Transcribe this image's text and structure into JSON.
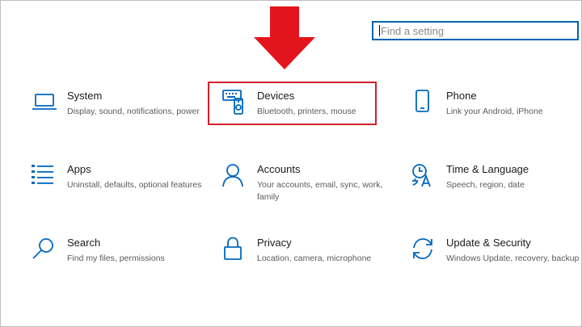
{
  "search": {
    "placeholder": "Find a setting"
  },
  "tiles": [
    {
      "title": "System",
      "desc": "Display, sound, notifications, power",
      "icon": "laptop-icon"
    },
    {
      "title": "Devices",
      "desc": "Bluetooth, printers, mouse",
      "icon": "devices-icon"
    },
    {
      "title": "Phone",
      "desc": "Link your Android, iPhone",
      "icon": "phone-icon"
    },
    {
      "title": "Apps",
      "desc": "Uninstall, defaults, optional features",
      "icon": "apps-list-icon"
    },
    {
      "title": "Accounts",
      "desc": "Your accounts, email, sync, work, family",
      "icon": "person-icon"
    },
    {
      "title": "Time & Language",
      "desc": "Speech, region, date",
      "icon": "time-language-icon"
    },
    {
      "title": "Search",
      "desc": "Find my files, permissions",
      "icon": "search-icon"
    },
    {
      "title": "Privacy",
      "desc": "Location, camera, microphone",
      "icon": "lock-icon"
    },
    {
      "title": "Update & Security",
      "desc": "Windows Update, recovery, backup",
      "icon": "sync-icon"
    }
  ],
  "colors": {
    "accent": "#0067c0",
    "highlight": "#d0202a",
    "arrow": "#e3141c"
  }
}
